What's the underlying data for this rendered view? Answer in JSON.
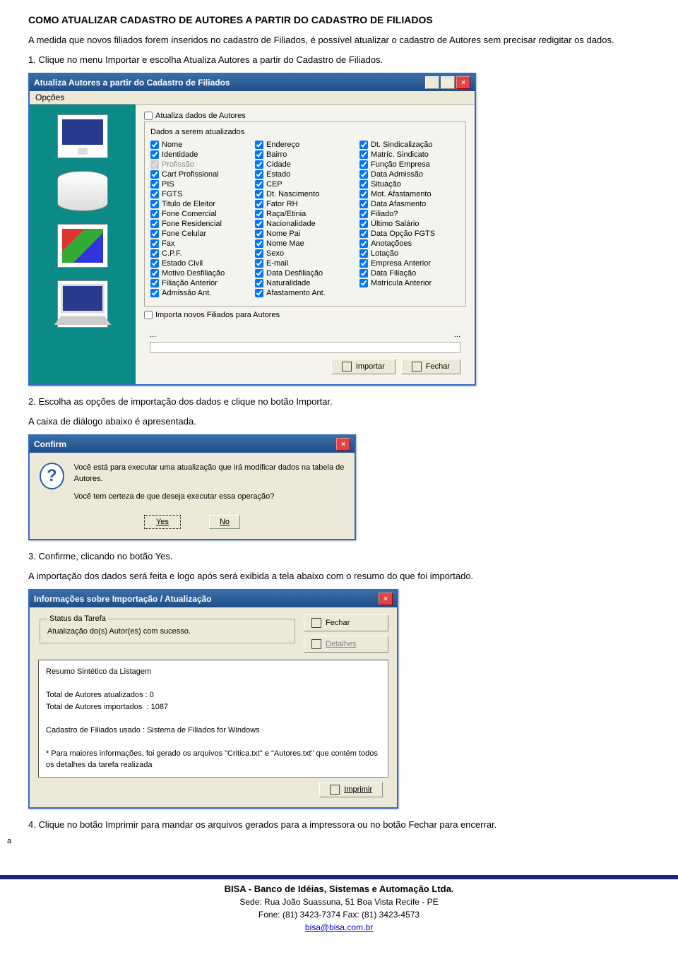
{
  "doc": {
    "title": "COMO ATUALIZAR CADASTRO DE AUTORES A PARTIR DO CADASTRO DE FILIADOS",
    "intro": "A medida que novos filiados forem inseridos no cadastro de Filiados, é possível atualizar o cadastro de Autores sem precisar redigitar os dados.",
    "step1": "1. Clique no menu Importar e escolha Atualiza Autores a partir do Cadastro de Filiados.",
    "step2": "2. Escolha as opções de importação dos dados e clique no botão Importar.",
    "step2b": "A caixa de diálogo abaixo é apresentada.",
    "step3": "3. Confirme, clicando no botão Yes.",
    "step3b": "A importação dos dados será feita e logo após será exibida a tela abaixo com o resumo do que foi importado.",
    "step4": "4. Clique no botão Imprimir para mandar os arquivos gerados para a impressora ou no botão Fechar para encerrar.",
    "corner": "a"
  },
  "win1": {
    "title": "Atualiza Autores a partir do Cadastro de Filiados",
    "menu": "Opções",
    "chk_top": "Atualiza dados de Autores",
    "subtitle": "Dados a serem atualizados",
    "cols": [
      [
        "Nome",
        "Identidade",
        "Profissão",
        "Cart Profissional",
        "PIS",
        "FGTS",
        "Titulo de Eleitor",
        "Fone Comercial",
        "Fone Residencial",
        "Fone Celular",
        "Fax",
        "C.P.F.",
        "Estado Civil",
        "Motivo Desfiliação",
        "Filiação Anterior",
        "Admissão Ant."
      ],
      [
        "Endereço",
        "Bairro",
        "Cidade",
        "Estado",
        "CEP",
        "Dt. Nascimento",
        "Fator RH",
        "Raça/Etinia",
        "Nacionalidade",
        "Nome Pai",
        "Nome Mae",
        "Sexo",
        "E-mail",
        "Data Desfiliação",
        "Naturalidade",
        "Afastamento Ant."
      ],
      [
        "Dt. Sindicalização",
        "Matríc. Sindicato",
        "Função Empresa",
        "Data Admissão",
        "Situação",
        "Mot. Afastamento",
        "Data Afasmento",
        "Filiado?",
        "Último Salário",
        "Data Opção FGTS",
        "Anotaçõoes",
        "Lotação",
        "Empresa Anterior",
        "Data Filiação",
        "Matrícula Anterior"
      ]
    ],
    "chk_bottom": "Importa novos Filiados para Autores",
    "ellipsis": "...",
    "btn_import": "Importar",
    "btn_close": "Fechar"
  },
  "confirm": {
    "title": "Confirm",
    "line1": "Você está para executar uma atualização que irá modificar dados na tabela de Autores.",
    "line2": "Você tem certeza de que deseja executar essa operação?",
    "yes": "Yes",
    "no": "No"
  },
  "info": {
    "title": "Informações sobre Importação / Atualização",
    "group": "Status da Tarefa",
    "status": "Atualização do(s) Autor(es) com sucesso.",
    "btn_close": "Fechar",
    "btn_details": "Detalhes",
    "resume": "Resumo Sintético da Listagem\n\nTotal de Autores atualizados : 0\nTotal de Autores importados  : 1087\n\nCadastro de Filiados usado : Sistema de Filiados for Windows\n\n* Para maiores informações, foi gerado os arquivos \"Critica.txt\" e \"Autores.txt\" que contém todos os detalhes da tarefa realizada",
    "btn_print": "Imprimir"
  },
  "footer": {
    "company": "BISA - Banco de Idéias, Sistemas e Automação Ltda.",
    "address": "Sede: Rua João Suassuna, 51 Boa Vista Recife - PE",
    "phone": "Fone: (81) 3423-7374 Fax: (81) 3423-4573",
    "email": "bisa@bisa.com.br"
  }
}
